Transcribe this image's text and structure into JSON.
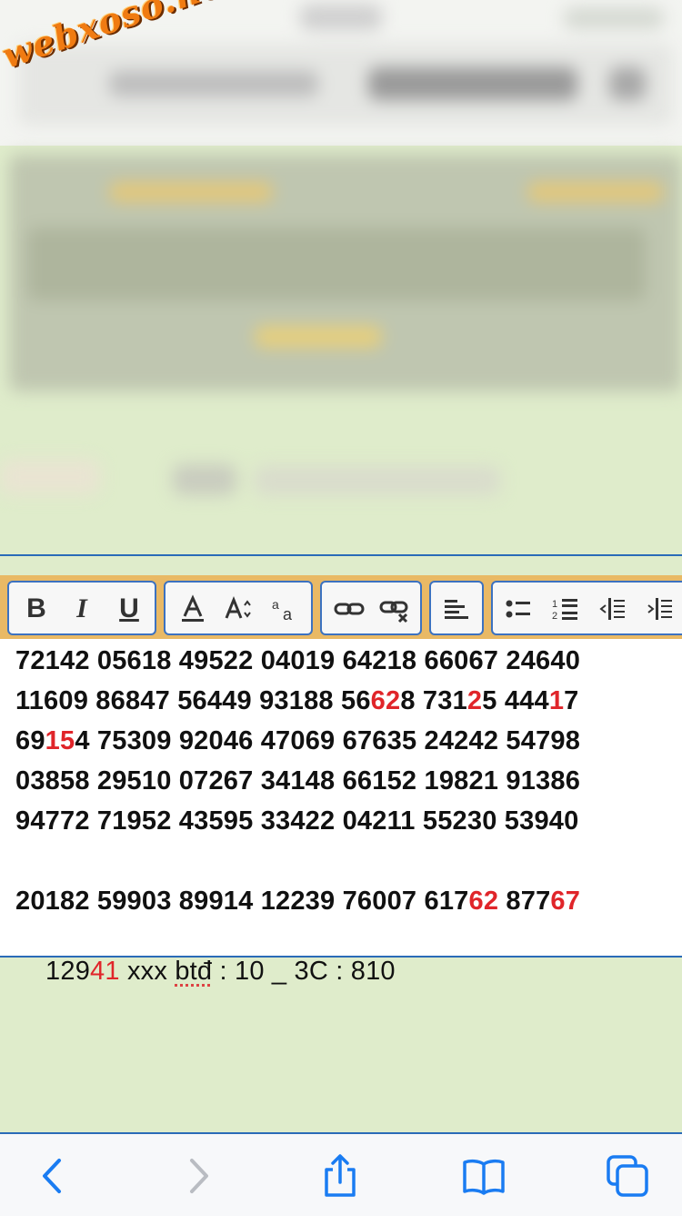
{
  "watermark": "webxoso.net",
  "toolbar": {
    "bold": "B",
    "italic": "I",
    "underline": "U"
  },
  "editor": {
    "rows": [
      [
        {
          "t": "72142 05618 49522 04019 64218 66067 24640",
          "red": false
        }
      ],
      [
        {
          "t": "11609 86847 56449 93188 56",
          "red": false
        },
        {
          "t": "62",
          "red": true
        },
        {
          "t": "8 731",
          "red": false
        },
        {
          "t": "2",
          "red": true
        },
        {
          "t": "5 444",
          "red": false
        },
        {
          "t": "1",
          "red": true
        },
        {
          "t": "7",
          "red": false
        }
      ],
      [
        {
          "t": "69",
          "red": false
        },
        {
          "t": "15",
          "red": true
        },
        {
          "t": "4 75309 92046 47069 67635 24242 54798",
          "red": false
        }
      ],
      [
        {
          "t": "03858 29510 07267 34148 66152 19821 91386",
          "red": false
        }
      ],
      [
        {
          "t": "94772 71952 43595 33422 04211 55230 53940",
          "red": false
        }
      ],
      [
        {
          "t": "20182 59903 89914 12239 76007 617",
          "red": false
        },
        {
          "t": "62",
          "red": true
        },
        {
          "t": " 877",
          "red": false
        },
        {
          "t": "67",
          "red": true
        }
      ]
    ],
    "last_line": {
      "prefix": "129",
      "red": "41",
      "mid": " xxx ",
      "spell_word": "btđ",
      "suffix": " : 10 _ 3C : 810"
    }
  },
  "colors": {
    "accent": "#2a6bb8",
    "highlight": "#e0252a",
    "toolbar_bg": "#e9b965",
    "page_bg": "#dfeccb"
  }
}
